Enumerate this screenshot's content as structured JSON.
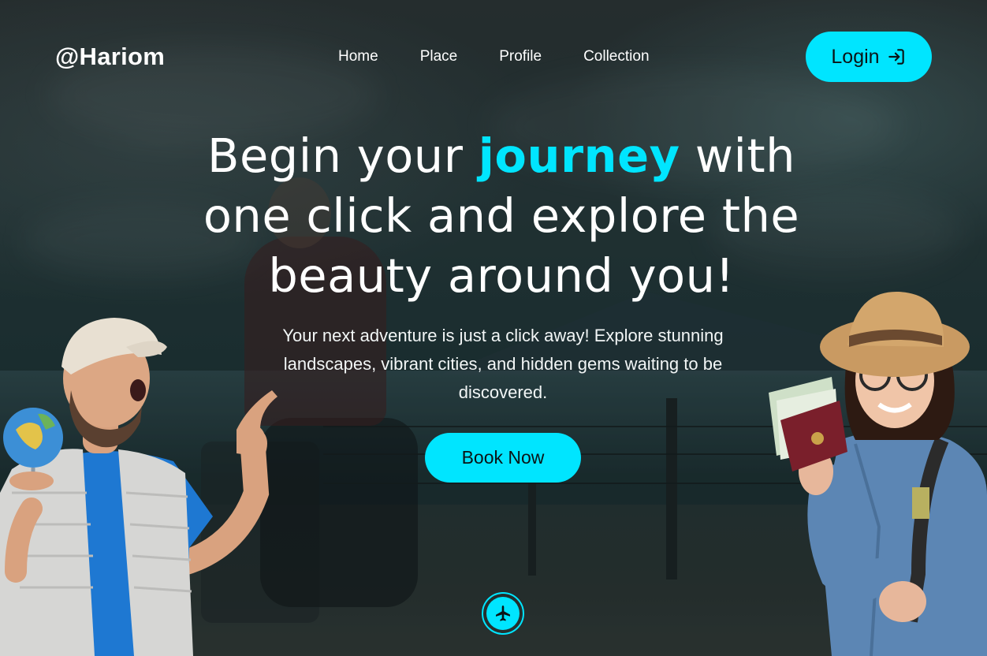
{
  "brand": {
    "logo": "@Hariom"
  },
  "nav": {
    "items": [
      {
        "label": "Home"
      },
      {
        "label": "Place"
      },
      {
        "label": "Profile"
      },
      {
        "label": "Collection"
      }
    ],
    "login_label": "Login"
  },
  "hero": {
    "headline_before": "Begin your ",
    "headline_accent": "journey",
    "headline_after": " with one click and explore the beauty around you!",
    "subtext": "Your next adventure is just a click away! Explore stunning landscapes, vibrant cities, and hidden gems waiting to be discovered.",
    "cta_label": "Book Now"
  },
  "colors": {
    "accent": "#00e5ff",
    "text": "#ffffff",
    "button_text": "#0b1416"
  },
  "icons": {
    "login": "login-arrow-icon",
    "scroll": "airplane-icon"
  }
}
